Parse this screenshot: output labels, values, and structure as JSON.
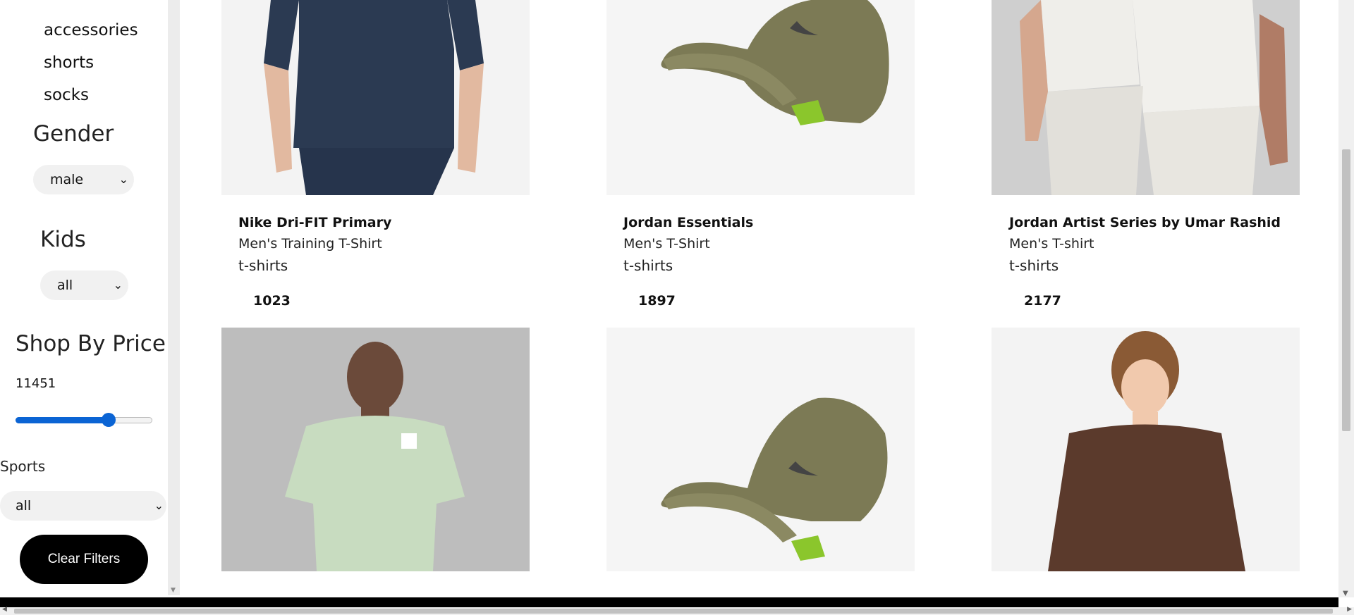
{
  "sidebar": {
    "categories": [
      "accessories",
      "shorts",
      "socks"
    ],
    "gender": {
      "title": "Gender",
      "selected": "male"
    },
    "kids": {
      "title": "Kids",
      "selected": "all"
    },
    "price": {
      "title": "Shop By Price",
      "value": "11451",
      "fraction": 0.68
    },
    "sports": {
      "label": "Sports",
      "selected": "all"
    },
    "clear_label": "Clear Filters"
  },
  "products": [
    {
      "title": "Nike Dri-FIT Primary",
      "subtitle": "Men's Training T-Shirt",
      "category": "t-shirts",
      "price": "1023"
    },
    {
      "title": "Jordan Essentials",
      "subtitle": "Men's T-Shirt",
      "category": "t-shirts",
      "price": "1897"
    },
    {
      "title": "Jordan Artist Series by Umar Rashid",
      "subtitle": "Men's T-shirt",
      "category": "t-shirts",
      "price": "2177"
    }
  ],
  "icons": {
    "chevron": "chevron-down-icon",
    "swoosh": "swoosh-icon"
  }
}
